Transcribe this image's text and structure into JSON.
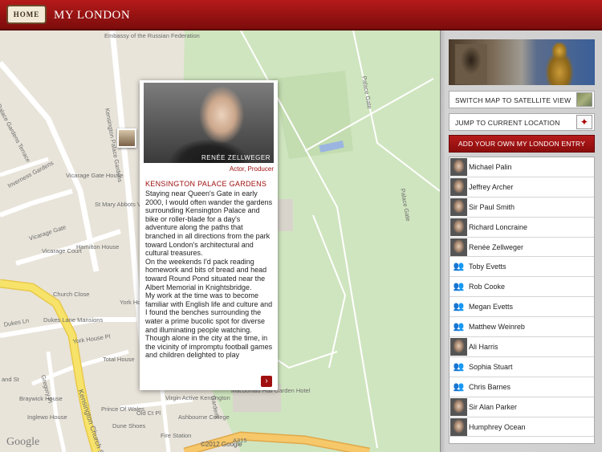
{
  "header": {
    "home_label": "HOME",
    "title": "MY LONDON"
  },
  "map": {
    "labels": [
      "Embassy of the Russian Federation",
      "Palace Gardens Terrace",
      "Kensington Palace Gardens",
      "Inverness Gardens",
      "Vicarage Gate House",
      "St Mary Abbots Vicarage",
      "Vicarage Gate",
      "Hamilton House",
      "Vicarage Court",
      "Church Close",
      "York Ho",
      "Dukes Ln",
      "Dukes Lane Mansions",
      "York House Pl",
      "Total House",
      "Gregory Pl",
      "Braywick House",
      "Inglewo House",
      "Kensington Church St",
      "Prince Of Wales",
      "Old Ct Pl",
      "Virgin Active Kensington",
      "Ashbourne College",
      "Dune Shoes",
      "Fire Station",
      "Macdonald Hall Garden Hotel",
      "A315",
      "Palace Gate",
      "Palace Gate",
      "Gardens",
      "and St",
      "Google"
    ],
    "copyright": "©2012 Google"
  },
  "popup": {
    "name": "RENÉE ZELLWEGER",
    "role": "Actor, Producer",
    "place": "KENSINGTON PALACE GARDENS",
    "text": "Staying near Queen's Gate in early 2000, I would often wander the gardens surrounding Kensington Palace and bike or roller-blade for a day's adventure along the paths that branched in all directions from the park toward London's architectural and cultural treasures.\nOn the weekends I'd pack reading homework and bits of bread and head toward Round Pond situated near the Albert Memorial in Knightsbridge.\nMy work at the time was to become familiar with English life and culture and I found the benches surrounding the water a prime bucolic spot for diverse and illuminating people watching.\nThough alone in the city at the time, in the vicinity of impromptu football games and children delighted to play"
  },
  "sidebar": {
    "satellite_label": "SWITCH MAP TO SATELLITE VIEW",
    "location_label": "JUMP TO CURRENT LOCATION",
    "add_label": "ADD YOUR OWN MY LONDON ENTRY",
    "people": [
      {
        "name": "Michael Palin",
        "thumb": "photo"
      },
      {
        "name": "Jeffrey Archer",
        "thumb": "photo"
      },
      {
        "name": "Sir Paul Smith",
        "thumb": "photo"
      },
      {
        "name": "Richard Loncraine",
        "thumb": "photo"
      },
      {
        "name": "Renée Zellweger",
        "thumb": "photo"
      },
      {
        "name": "Toby Evetts",
        "thumb": "generic"
      },
      {
        "name": "Rob Cooke",
        "thumb": "generic"
      },
      {
        "name": "Megan Evetts",
        "thumb": "generic"
      },
      {
        "name": "Matthew Weinreb",
        "thumb": "generic"
      },
      {
        "name": "Ali Harris",
        "thumb": "photo"
      },
      {
        "name": "Sophia Stuart",
        "thumb": "generic"
      },
      {
        "name": "Chris Barnes",
        "thumb": "generic"
      },
      {
        "name": "Sir Alan Parker",
        "thumb": "photo"
      },
      {
        "name": "Humphrey Ocean",
        "thumb": "photo"
      }
    ]
  },
  "colors": {
    "accent": "#a00f0f",
    "park": "#cfe5bf",
    "road_major": "#f7e36a"
  }
}
